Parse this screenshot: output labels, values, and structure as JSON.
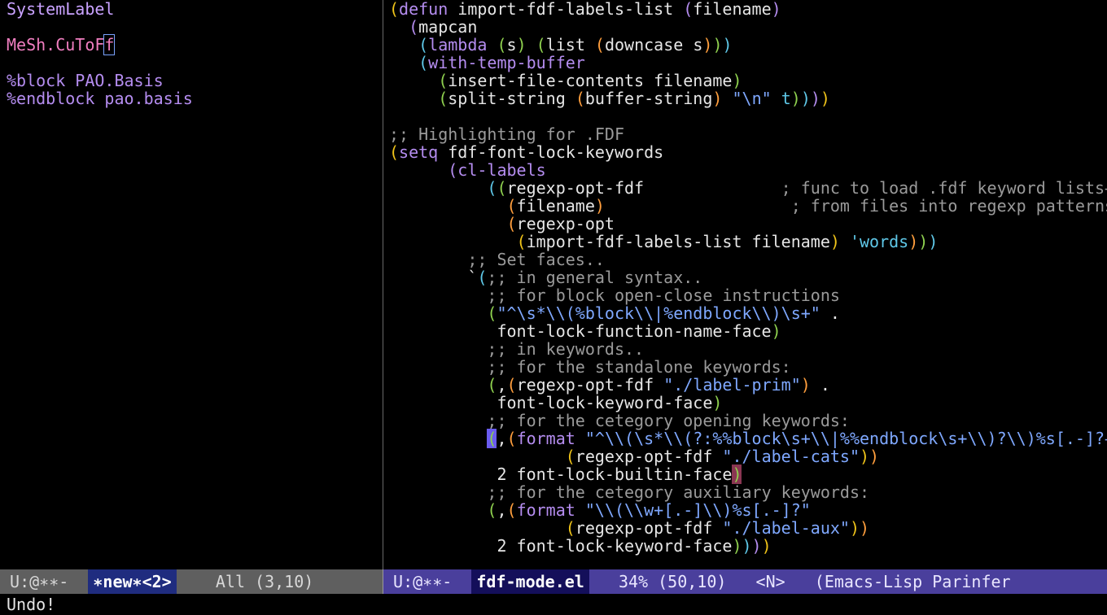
{
  "colors": {
    "default": "#e6e6e6",
    "comment": "#9a9a9a",
    "keyword": "#b58df0",
    "string": "#7fa8ff",
    "constant": "#5fc8e8",
    "builtin": "#c9a2ff",
    "rd1": "#f0c419",
    "rd2": "#b58df0",
    "rd3": "#5fc8e8",
    "rd4": "#8fd14f",
    "rd5": "#ff9e3d",
    "pink": "#f07ec0"
  },
  "left_pane": {
    "buffer_lines": [
      [
        {
          "t": "SystemLabel",
          "c": "builtin"
        }
      ],
      [],
      [
        {
          "t": "MeSh.CuToF",
          "c": "pink"
        },
        {
          "t": "f",
          "c": "pink",
          "f": "cursor-box"
        }
      ],
      [],
      [
        {
          "t": "%block PAO.Basis",
          "c": "keyword"
        }
      ],
      [
        {
          "t": "%endblock pao.basis",
          "c": "keyword"
        }
      ]
    ]
  },
  "right_pane": {
    "buffer_lines": [
      [
        {
          "t": "(",
          "c": "rd1"
        },
        {
          "t": "defun",
          "c": "keyword"
        },
        {
          "t": " import-fdf-labels-list ",
          "c": "default"
        },
        {
          "t": "(",
          "c": "rd2"
        },
        {
          "t": "filename",
          "c": "default"
        },
        {
          "t": ")",
          "c": "rd2"
        }
      ],
      [
        {
          "t": "  ",
          "c": "default"
        },
        {
          "t": "(",
          "c": "rd2"
        },
        {
          "t": "mapcan",
          "c": "default"
        }
      ],
      [
        {
          "t": "   ",
          "c": "default"
        },
        {
          "t": "(",
          "c": "rd3"
        },
        {
          "t": "lambda",
          "c": "keyword"
        },
        {
          "t": " ",
          "c": "default"
        },
        {
          "t": "(",
          "c": "rd4"
        },
        {
          "t": "s",
          "c": "default"
        },
        {
          "t": ")",
          "c": "rd4"
        },
        {
          "t": " ",
          "c": "default"
        },
        {
          "t": "(",
          "c": "rd4"
        },
        {
          "t": "list ",
          "c": "default"
        },
        {
          "t": "(",
          "c": "rd5"
        },
        {
          "t": "downcase s",
          "c": "default"
        },
        {
          "t": ")",
          "c": "rd5"
        },
        {
          "t": ")",
          "c": "rd4"
        },
        {
          "t": ")",
          "c": "rd3"
        }
      ],
      [
        {
          "t": "   ",
          "c": "default"
        },
        {
          "t": "(",
          "c": "rd3"
        },
        {
          "t": "with-temp-buffer",
          "c": "keyword"
        }
      ],
      [
        {
          "t": "     ",
          "c": "default"
        },
        {
          "t": "(",
          "c": "rd4"
        },
        {
          "t": "insert-file-contents filename",
          "c": "default"
        },
        {
          "t": ")",
          "c": "rd4"
        }
      ],
      [
        {
          "t": "     ",
          "c": "default"
        },
        {
          "t": "(",
          "c": "rd4"
        },
        {
          "t": "split-string ",
          "c": "default"
        },
        {
          "t": "(",
          "c": "rd5"
        },
        {
          "t": "buffer-string",
          "c": "default"
        },
        {
          "t": ")",
          "c": "rd5"
        },
        {
          "t": " ",
          "c": "default"
        },
        {
          "t": "\"\\n\"",
          "c": "string"
        },
        {
          "t": " ",
          "c": "default"
        },
        {
          "t": "t",
          "c": "constant"
        },
        {
          "t": ")",
          "c": "rd4"
        },
        {
          "t": ")",
          "c": "rd3"
        },
        {
          "t": ")",
          "c": "rd2"
        },
        {
          "t": ")",
          "c": "rd1"
        }
      ],
      [],
      [
        {
          "t": ";; Highlighting for .FDF",
          "c": "comment"
        }
      ],
      [
        {
          "t": "(",
          "c": "rd1"
        },
        {
          "t": "setq",
          "c": "keyword"
        },
        {
          "t": " fdf-font-lock-keywords",
          "c": "default"
        }
      ],
      [
        {
          "t": "      ",
          "c": "default"
        },
        {
          "t": "(",
          "c": "rd2"
        },
        {
          "t": "cl-labels",
          "c": "keyword"
        }
      ],
      [
        {
          "t": "          ",
          "c": "default"
        },
        {
          "t": "(",
          "c": "rd3"
        },
        {
          "t": "(",
          "c": "rd4"
        },
        {
          "t": "regexp-opt-fdf              ",
          "c": "default"
        },
        {
          "t": "; func to load .fdf keyword lists→",
          "c": "comment"
        }
      ],
      [
        {
          "t": "            ",
          "c": "default"
        },
        {
          "t": "(",
          "c": "rd5"
        },
        {
          "t": "filename",
          "c": "default"
        },
        {
          "t": ")",
          "c": "rd5"
        },
        {
          "t": "                   ",
          "c": "default"
        },
        {
          "t": "; from files into regexp patterns→",
          "c": "comment"
        }
      ],
      [
        {
          "t": "            ",
          "c": "default"
        },
        {
          "t": "(",
          "c": "rd5"
        },
        {
          "t": "regexp-opt",
          "c": "default"
        }
      ],
      [
        {
          "t": "             ",
          "c": "default"
        },
        {
          "t": "(",
          "c": "rd1"
        },
        {
          "t": "import-fdf-labels-list filename",
          "c": "default"
        },
        {
          "t": ")",
          "c": "rd1"
        },
        {
          "t": " ",
          "c": "default"
        },
        {
          "t": "'words",
          "c": "constant"
        },
        {
          "t": ")",
          "c": "rd5"
        },
        {
          "t": ")",
          "c": "rd4"
        },
        {
          "t": ")",
          "c": "rd3"
        }
      ],
      [
        {
          "t": "        ",
          "c": "default"
        },
        {
          "t": ";; Set faces..",
          "c": "comment"
        }
      ],
      [
        {
          "t": "        ",
          "c": "default"
        },
        {
          "t": "`",
          "c": "default"
        },
        {
          "t": "(",
          "c": "rd3"
        },
        {
          "t": ";; in general syntax..",
          "c": "comment"
        }
      ],
      [
        {
          "t": "          ",
          "c": "default"
        },
        {
          "t": ";; for block open-close instructions",
          "c": "comment"
        }
      ],
      [
        {
          "t": "          ",
          "c": "default"
        },
        {
          "t": "(",
          "c": "rd4"
        },
        {
          "t": "\"^\\s*\\\\(%block\\\\|%endblock\\\\)\\s+\"",
          "c": "string"
        },
        {
          "t": " .",
          "c": "default"
        }
      ],
      [
        {
          "t": "           font-lock-function-name-face",
          "c": "default"
        },
        {
          "t": ")",
          "c": "rd4"
        }
      ],
      [
        {
          "t": "          ",
          "c": "default"
        },
        {
          "t": ";; in keywords..",
          "c": "comment"
        }
      ],
      [
        {
          "t": "          ",
          "c": "default"
        },
        {
          "t": ";; for the standalone keywords:",
          "c": "comment"
        }
      ],
      [
        {
          "t": "          ",
          "c": "default"
        },
        {
          "t": "(",
          "c": "rd4"
        },
        {
          "t": ",",
          "c": "default"
        },
        {
          "t": "(",
          "c": "rd5"
        },
        {
          "t": "regexp-opt-fdf ",
          "c": "default"
        },
        {
          "t": "\"./label-prim\"",
          "c": "string"
        },
        {
          "t": ")",
          "c": "rd5"
        },
        {
          "t": " .",
          "c": "default"
        }
      ],
      [
        {
          "t": "           font-lock-keyword-face",
          "c": "default"
        },
        {
          "t": ")",
          "c": "rd4"
        }
      ],
      [
        {
          "t": "          ",
          "c": "default"
        },
        {
          "t": ";; for the cetegory opening keywords:",
          "c": "comment"
        }
      ],
      [
        {
          "t": "          ",
          "c": "default"
        },
        {
          "t": "(",
          "c": "rd4",
          "f": "cursor-fill"
        },
        {
          "t": ",",
          "c": "default"
        },
        {
          "t": "(",
          "c": "rd5"
        },
        {
          "t": "format",
          "c": "keyword"
        },
        {
          "t": " ",
          "c": "default"
        },
        {
          "t": "\"^\\\\(\\s*\\\\(?:%%block\\s+\\\\|%%endblock\\s+\\\\)?\\\\)%s[.-]?→",
          "c": "string"
        }
      ],
      [
        {
          "t": "                  ",
          "c": "default"
        },
        {
          "t": "(",
          "c": "rd1"
        },
        {
          "t": "regexp-opt-fdf ",
          "c": "default"
        },
        {
          "t": "\"./label-cats\"",
          "c": "string"
        },
        {
          "t": ")",
          "c": "rd1"
        },
        {
          "t": ")",
          "c": "rd5"
        }
      ],
      [
        {
          "t": "           2 font-lock-builtin-face",
          "c": "default"
        },
        {
          "t": ")",
          "c": "rd4",
          "f": "paren-match"
        }
      ],
      [
        {
          "t": "          ",
          "c": "default"
        },
        {
          "t": ";; for the cetegory auxiliary keywords:",
          "c": "comment"
        }
      ],
      [
        {
          "t": "          ",
          "c": "default"
        },
        {
          "t": "(",
          "c": "rd4"
        },
        {
          "t": ",",
          "c": "default"
        },
        {
          "t": "(",
          "c": "rd5"
        },
        {
          "t": "format",
          "c": "keyword"
        },
        {
          "t": " ",
          "c": "default"
        },
        {
          "t": "\"\\\\(\\\\w+[.-]\\\\)%s[.-]?\"",
          "c": "string"
        }
      ],
      [
        {
          "t": "                  ",
          "c": "default"
        },
        {
          "t": "(",
          "c": "rd1"
        },
        {
          "t": "regexp-opt-fdf ",
          "c": "default"
        },
        {
          "t": "\"./label-aux\"",
          "c": "string"
        },
        {
          "t": ")",
          "c": "rd1"
        },
        {
          "t": ")",
          "c": "rd5"
        }
      ],
      [
        {
          "t": "           2 font-lock-keyword-face",
          "c": "default"
        },
        {
          "t": ")",
          "c": "rd4"
        },
        {
          "t": ")",
          "c": "rd3"
        },
        {
          "t": ")",
          "c": "rd2"
        },
        {
          "t": ")",
          "c": "rd1"
        }
      ]
    ]
  },
  "modeline_left": {
    "status": " U:@∗∗-  ",
    "buffer": "∗new∗<2>",
    "position": "    All (3,10)"
  },
  "modeline_right": {
    "status": " U:@∗∗-  ",
    "buffer": "fdf-mode.el",
    "position": "   34% (50,10)   <N>   (Emacs-Lisp Parinfer"
  },
  "echo_area": {
    "message": "Undo!"
  }
}
